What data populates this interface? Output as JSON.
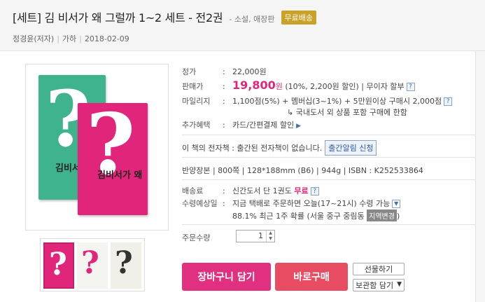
{
  "header": {
    "title": "[세트] 김 비서가 왜 그럴까 1~2 세트 - 전2권",
    "subtitle": "- 소설, 애장판",
    "badge": "무료배송",
    "author": "정경윤(저자)",
    "publisher": "가하",
    "date": "2018-02-09"
  },
  "cover": {
    "book_title": "김비서가 왜",
    "qmark": "?",
    "thumb_qmark": "?"
  },
  "info": {
    "list_price_label": "정가",
    "list_price": "22,000원",
    "sale_label": "판매가",
    "sale_price": "19,800",
    "sale_unit": "원",
    "discount": "(10%, 2,200원 할인)",
    "installment": "| 무이자 할부",
    "mileage_label": "마일리지",
    "mileage": "1,100점(5%) + 멤버십(3~1%) + 5만원이상 구매시 2,000점",
    "mileage_note": "↳ 국내도서 외 상품 포함 구매에 한함",
    "benefit_label": "추가혜택",
    "benefit": "카드/간편결제 할인",
    "ebook_text": "이 책의 전자책 : 출간된 전자책이 없습니다.",
    "notify_button": "출간알림 신청",
    "specs": "반양장본 | 800쪽 | 128*188mm (B6) | 944g | ISBN : K252533864",
    "shipping_label": "배송료",
    "shipping": "신간도서 단 1권도",
    "shipping_free": "무료",
    "delivery_label": "수령예상일",
    "delivery": "지금 택배로 주문하면 오늘(17~21시) 수령 가능",
    "delivery_stat": "88.1% 최근 1주 확률 (서울 중구 중림동",
    "region_button": "지역변경",
    "delivery_close": ")",
    "qty_label": "주문수량",
    "qty_value": "1",
    "help_icon": "?",
    "colon": ":"
  },
  "actions": {
    "cart": "장바구니 담기",
    "buy": "바로구매",
    "gift": "선물하기",
    "save": "보관함 담기"
  }
}
